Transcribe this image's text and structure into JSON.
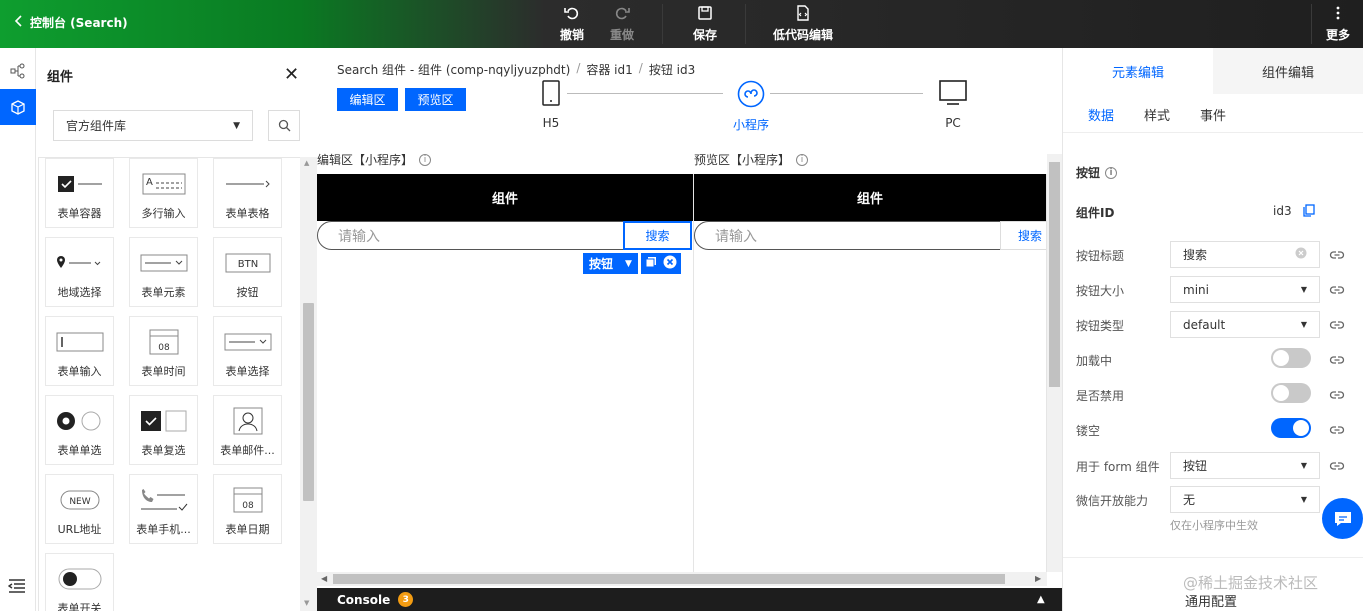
{
  "topbar": {
    "title": "控制台 (Search)",
    "undo": "撤销",
    "redo": "重做",
    "save": "保存",
    "lowcode": "低代码编辑",
    "more": "更多"
  },
  "components_panel": {
    "title": "组件",
    "library": "官方组件库",
    "items": [
      {
        "label": "表单容器",
        "icon": "form-container-icon"
      },
      {
        "label": "多行输入",
        "icon": "textarea-icon"
      },
      {
        "label": "表单表格",
        "icon": "form-table-icon"
      },
      {
        "label": "地域选择",
        "icon": "region-select-icon"
      },
      {
        "label": "表单元素",
        "icon": "form-element-icon"
      },
      {
        "label": "按钮",
        "icon": "button-icon",
        "icon_text": "BTN"
      },
      {
        "label": "表单输入",
        "icon": "form-input-icon"
      },
      {
        "label": "表单时间",
        "icon": "form-time-icon",
        "icon_text": "08"
      },
      {
        "label": "表单选择",
        "icon": "form-select-icon"
      },
      {
        "label": "表单单选",
        "icon": "radio-icon"
      },
      {
        "label": "表单复选",
        "icon": "checkbox-icon"
      },
      {
        "label": "表单邮件...",
        "icon": "email-icon"
      },
      {
        "label": "URL地址",
        "icon": "url-icon",
        "icon_text": "NEW"
      },
      {
        "label": "表单手机...",
        "icon": "phone-icon"
      },
      {
        "label": "表单日期",
        "icon": "form-date-icon",
        "icon_text": "08"
      },
      {
        "label": "表单开关",
        "icon": "switch-icon"
      }
    ]
  },
  "main": {
    "breadcrumb": [
      "Search 组件 - 组件 (comp-nqyljyuzphdt)",
      "容器 id1",
      "按钮 id3"
    ],
    "edit_btn": "编辑区",
    "preview_btn": "预览区",
    "devices": [
      {
        "label": "H5"
      },
      {
        "label": "小程序"
      },
      {
        "label": "PC"
      }
    ],
    "edit_area_label": "编辑区【小程序】",
    "preview_area_label": "预览区【小程序】",
    "phone_title": "组件",
    "input_placeholder": "请输入",
    "search_btn": "搜索",
    "selected_tag": "按钮",
    "console": "Console",
    "console_count": "3"
  },
  "right": {
    "tab_element": "元素编辑",
    "tab_component": "组件编辑",
    "sub_data": "数据",
    "sub_style": "样式",
    "sub_event": "事件",
    "section_title": "按钮",
    "component_id_label": "组件ID",
    "component_id": "id3",
    "props": {
      "title_label": "按钮标题",
      "title_value": "搜索",
      "size_label": "按钮大小",
      "size_value": "mini",
      "type_label": "按钮类型",
      "type_value": "default",
      "loading_label": "加载中",
      "loading": false,
      "disabled_label": "是否禁用",
      "disabled": false,
      "hollow_label": "镂空",
      "hollow": true,
      "form_label": "用于 form 组件",
      "form_value": "按钮",
      "wechat_label": "微信开放能力",
      "wechat_value": "无",
      "wechat_hint": "仅在小程序中生效"
    },
    "common_config": "通用配置"
  },
  "watermark": "@稀土掘金技术社区",
  "colors": {
    "accent": "#0066ff",
    "topbar_green": "#0e9e2f",
    "topbar_dark": "#1f1f1f"
  }
}
